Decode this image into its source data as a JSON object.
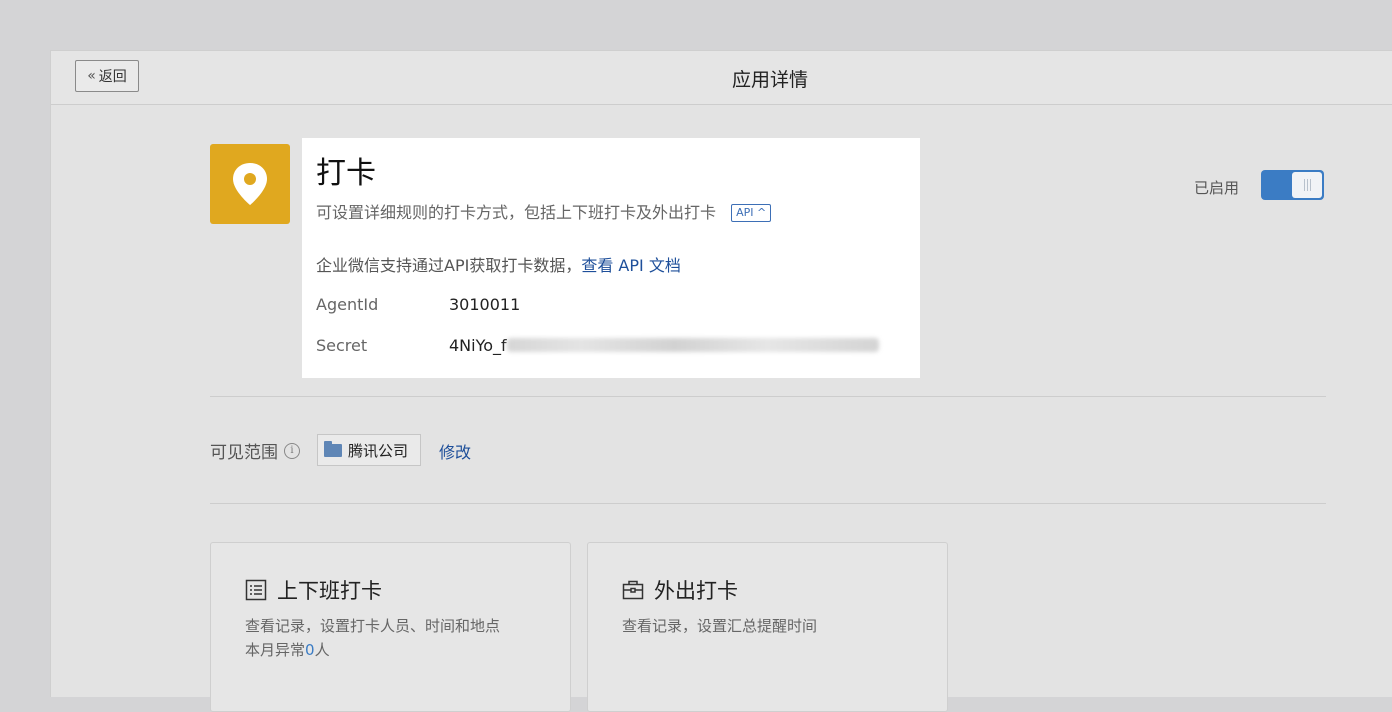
{
  "header": {
    "back_label": "返回",
    "back_chevron": "«",
    "title": "应用详情"
  },
  "app": {
    "icon": "location-pin-icon",
    "icon_color": "#e0a81f",
    "name": "打卡",
    "description": "可设置详细规则的打卡方式，包括上下班打卡及外出打卡",
    "api_tag": "API ^",
    "api_text": "企业微信支持通过API获取打卡数据，",
    "api_link": "查看 API 文档",
    "agentid_label": "AgentId",
    "agentid_value": "3010011",
    "secret_label": "Secret",
    "secret_prefix": "4NiYo_f"
  },
  "status": {
    "label": "已启用",
    "enabled": true,
    "accent": "#3b7cc4"
  },
  "scope": {
    "label": "可见范围",
    "info_icon": "i",
    "department": "腾讯公司",
    "edit_label": "修改"
  },
  "features": [
    {
      "icon": "list-icon",
      "title": "上下班打卡",
      "desc": "查看记录，设置打卡人员、时间和地点",
      "anomaly_prefix": "本月异常",
      "anomaly_count": "0",
      "anomaly_suffix": "人"
    },
    {
      "icon": "briefcase-icon",
      "title": "外出打卡",
      "desc": "查看记录，设置汇总提醒时间"
    }
  ]
}
